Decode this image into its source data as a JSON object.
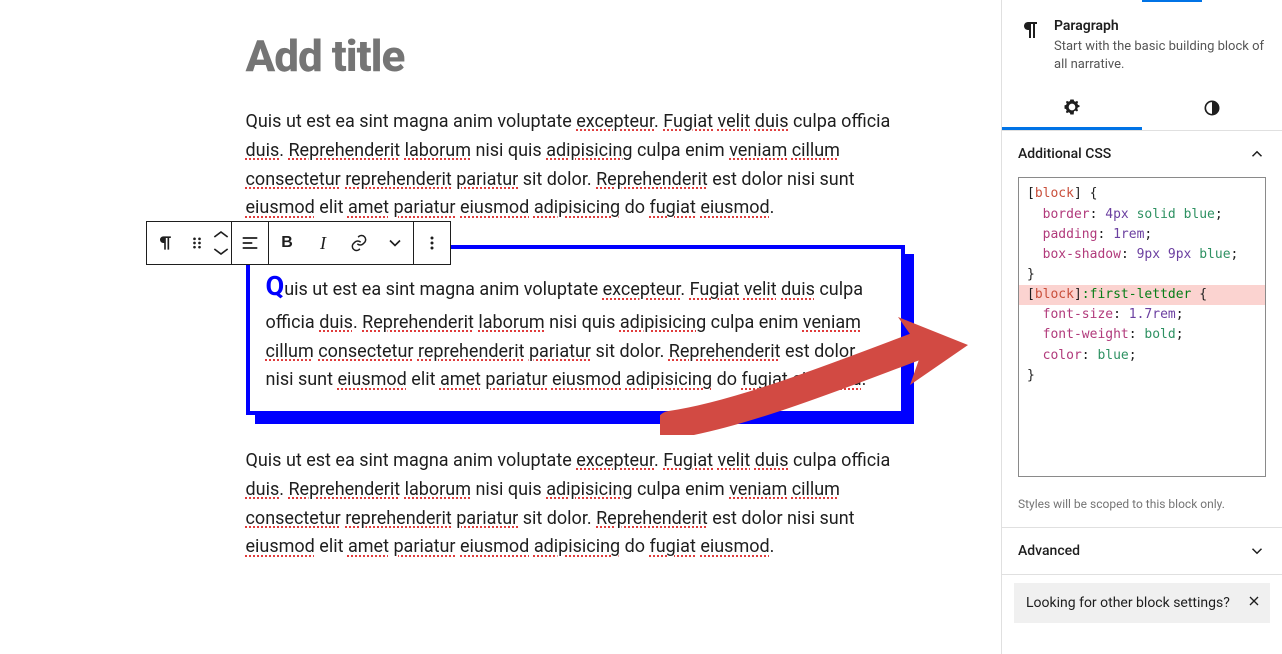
{
  "editor": {
    "title_placeholder": "Add title",
    "para1": "Quis ut est ea sint magna anim voluptate excepteur. Fugiat velit duis culpa officia duis. Reprehenderit laborum nisi quis adipisicing culpa enim veniam cillum consectetur reprehenderit pariatur sit dolor. Reprehenderit est dolor nisi sunt eiusmod elit amet pariatur eiusmod adipisicing do fugiat eiusmod.",
    "para2_cap": "Q",
    "para2_rest": "uis ut est ea sint magna anim voluptate excepteur. Fugiat velit duis culpa officia duis. Reprehenderit laborum nisi quis adipisicing culpa enim veniam cillum consectetur reprehenderit pariatur sit dolor. Reprehenderit est dolor nisi sunt eiusmod elit amet pariatur eiusmod adipisicing do fugiat eiusmod.",
    "para3": "Quis ut est ea sint magna anim voluptate excepteur. Fugiat velit duis culpa officia duis. Reprehenderit laborum nisi quis adipisicing culpa enim veniam cillum consectetur reprehenderit pariatur sit dolor. Reprehenderit est dolor nisi sunt eiusmod elit amet pariatur eiusmod adipisicing do fugiat eiusmod."
  },
  "toolbar": {
    "bold": "B",
    "italic": "I"
  },
  "sidebar": {
    "block_name": "Paragraph",
    "block_desc": "Start with the basic building block of all narrative.",
    "additional_css_label": "Additional CSS",
    "css_lines": [
      {
        "hl": false,
        "html": "<span class='tok-punc'>[</span><span class='tok-sel'>block</span><span class='tok-punc'>] {</span>"
      },
      {
        "hl": false,
        "html": "  <span class='tok-prop'>border</span><span class='tok-punc'>: </span><span class='tok-num'>4px</span> <span class='tok-kw'>solid</span> <span class='tok-kw'>blue</span><span class='tok-punc'>;</span>"
      },
      {
        "hl": false,
        "html": "  <span class='tok-prop'>padding</span><span class='tok-punc'>: </span><span class='tok-num'>1rem</span><span class='tok-punc'>;</span>"
      },
      {
        "hl": false,
        "html": "  <span class='tok-prop'>box-shadow</span><span class='tok-punc'>: </span><span class='tok-num'>9px</span> <span class='tok-num'>9px</span> <span class='tok-kw'>blue</span><span class='tok-punc'>;</span>"
      },
      {
        "hl": false,
        "html": "<span class='tok-punc'>}</span>"
      },
      {
        "hl": true,
        "html": "<span class='tok-punc'>[</span><span class='tok-sel'>block</span><span class='tok-punc'>]</span><span class='tok-pseudo'>:first-lettder</span> <span class='tok-punc'>{</span>"
      },
      {
        "hl": false,
        "html": "  <span class='tok-prop'>font-size</span><span class='tok-punc'>: </span><span class='tok-num'>1.7rem</span><span class='tok-punc'>;</span>"
      },
      {
        "hl": false,
        "html": "  <span class='tok-prop'>font-weight</span><span class='tok-punc'>: </span><span class='tok-kw'>bold</span><span class='tok-punc'>;</span>"
      },
      {
        "hl": false,
        "html": "  <span class='tok-prop'>color</span><span class='tok-punc'>: </span><span class='tok-kw'>blue</span><span class='tok-punc'>;</span>"
      },
      {
        "hl": false,
        "html": "<span class='tok-punc'>}</span>"
      }
    ],
    "scope_hint": "Styles will be scoped to this block only.",
    "advanced_label": "Advanced",
    "notice_text": "Looking for other block settings?"
  },
  "colors": {
    "accent": "#0073e6",
    "arrow": "#d24a43",
    "blue": "#0000ff"
  }
}
